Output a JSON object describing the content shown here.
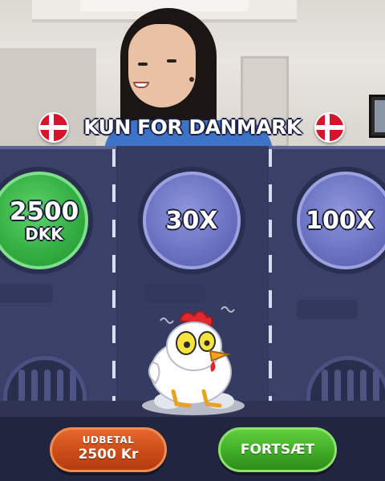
{
  "banner": {
    "text": "KUN FOR DANMARK"
  },
  "icons": {
    "left_flag": "denmark-flag-icon",
    "right_flag": "denmark-flag-icon"
  },
  "lanes": [
    {
      "line1": "2500",
      "line2": "DKK",
      "state": "collected",
      "color": "#3cb54a"
    },
    {
      "line1": "30X",
      "state": "multiplier",
      "color": "#6b72c0"
    },
    {
      "line1": "100X",
      "state": "multiplier",
      "color": "#6b72c0"
    }
  ],
  "buttons": {
    "cashout": {
      "label": "UDBETAL",
      "amount": "2500 Kr",
      "color": "#d45419"
    },
    "continue": {
      "label": "FORTSÆT",
      "color": "#45b42c"
    }
  }
}
